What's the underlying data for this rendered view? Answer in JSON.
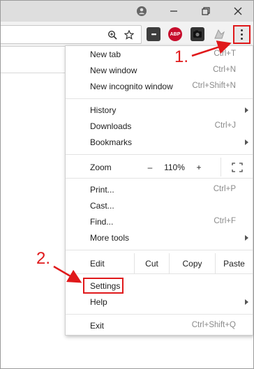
{
  "window": {
    "controls": [
      "minimize",
      "restore",
      "close"
    ],
    "profile_icon": "account-circle-icon"
  },
  "toolbar": {
    "omnibox_icons": [
      "zoom-icon",
      "bookmark-star-icon"
    ],
    "extensions": [
      {
        "name": "lastpass",
        "label": "•••"
      },
      {
        "name": "adblock-plus",
        "label": "ABP"
      },
      {
        "name": "camera",
        "label": ""
      },
      {
        "name": "pdf",
        "label": ""
      }
    ],
    "menu_button_icon": "three-dots-vertical-icon"
  },
  "menu": {
    "group1": [
      {
        "label": "New tab",
        "shortcut": "Ctrl+T"
      },
      {
        "label": "New window",
        "shortcut": "Ctrl+N"
      },
      {
        "label": "New incognito window",
        "shortcut": "Ctrl+Shift+N"
      }
    ],
    "group2": [
      {
        "label": "History",
        "shortcut": "",
        "submenu": true
      },
      {
        "label": "Downloads",
        "shortcut": "Ctrl+J",
        "submenu": false
      },
      {
        "label": "Bookmarks",
        "shortcut": "",
        "submenu": true
      }
    ],
    "zoom": {
      "label": "Zoom",
      "minus": "–",
      "value": "110%",
      "plus": "+"
    },
    "group3": [
      {
        "label": "Print...",
        "shortcut": "Ctrl+P"
      },
      {
        "label": "Cast...",
        "shortcut": ""
      },
      {
        "label": "Find...",
        "shortcut": "Ctrl+F"
      },
      {
        "label": "More tools",
        "shortcut": "",
        "submenu": true
      }
    ],
    "edit": {
      "label": "Edit",
      "cut": "Cut",
      "copy": "Copy",
      "paste": "Paste"
    },
    "group4": [
      {
        "label": "Settings",
        "shortcut": ""
      },
      {
        "label": "Help",
        "shortcut": "",
        "submenu": true
      }
    ],
    "exit": {
      "label": "Exit",
      "shortcut": "Ctrl+Shift+Q"
    }
  },
  "annotations": {
    "step1": "1.",
    "step2": "2.",
    "color": "#e0191b"
  }
}
